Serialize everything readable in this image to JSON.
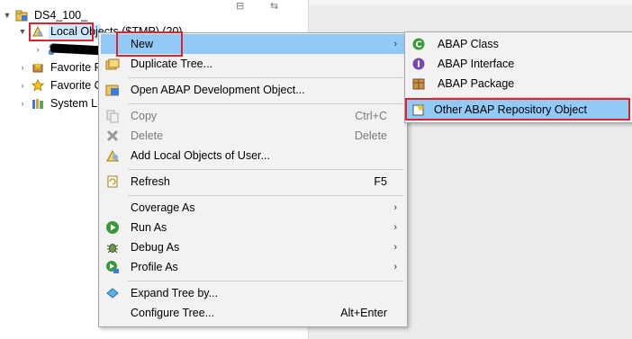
{
  "tree": {
    "root": {
      "label": "DS4_100_"
    },
    "items": [
      {
        "label": "Local Objects ($TMP) (20)"
      },
      {
        "label": ""
      },
      {
        "label": "Favorite P"
      },
      {
        "label": "Favorite O"
      },
      {
        "label": "System Li"
      }
    ]
  },
  "context_menu": {
    "items": [
      {
        "label": "New",
        "shortcut": "",
        "has_submenu": true
      },
      {
        "label": "Duplicate Tree...",
        "shortcut": ""
      },
      {
        "label": "Open ABAP Development Object...",
        "shortcut": ""
      },
      {
        "label": "Copy",
        "shortcut": "Ctrl+C",
        "disabled": true
      },
      {
        "label": "Delete",
        "shortcut": "Delete",
        "disabled": true
      },
      {
        "label": "Add Local Objects of User...",
        "shortcut": ""
      },
      {
        "label": "Refresh",
        "shortcut": "F5"
      },
      {
        "label": "Coverage As",
        "shortcut": "",
        "has_submenu": true
      },
      {
        "label": "Run As",
        "shortcut": "",
        "has_submenu": true
      },
      {
        "label": "Debug As",
        "shortcut": "",
        "has_submenu": true
      },
      {
        "label": "Profile As",
        "shortcut": "",
        "has_submenu": true
      },
      {
        "label": "Expand Tree by...",
        "shortcut": ""
      },
      {
        "label": "Configure Tree...",
        "shortcut": "Alt+Enter"
      }
    ],
    "submenu_arrow": "›"
  },
  "submenu": {
    "items": [
      {
        "label": "ABAP Class"
      },
      {
        "label": "ABAP Interface"
      },
      {
        "label": "ABAP Package"
      },
      {
        "label": "Other ABAP Repository Object"
      }
    ]
  },
  "colors": {
    "highlight": "#91c9f7",
    "annotation_red": "#e0202a",
    "menu_bg": "#f2f2f2"
  }
}
